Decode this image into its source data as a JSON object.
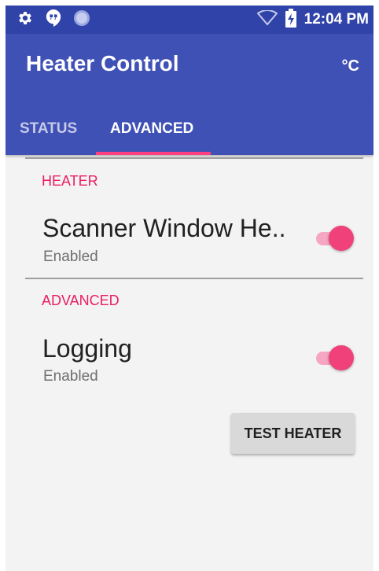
{
  "status_bar": {
    "time": "12:04 PM",
    "icons": [
      "settings-icon",
      "hangouts-icon",
      "sync-circle-icon",
      "wifi-icon",
      "battery-charging-icon"
    ]
  },
  "app_bar": {
    "title": "Heater Control",
    "unit_label": "°C"
  },
  "tabs": [
    {
      "label": "STATUS",
      "selected": false
    },
    {
      "label": "ADVANCED",
      "selected": true
    }
  ],
  "sections": [
    {
      "header": "HEATER",
      "preference": {
        "title": "Scanner Window He..",
        "summary": "Enabled",
        "enabled": true
      }
    },
    {
      "header": "ADVANCED",
      "preference": {
        "title": "Logging",
        "summary": "Enabled",
        "enabled": true
      }
    }
  ],
  "actions": {
    "test_heater_label": "TEST HEATER"
  },
  "colors": {
    "status_bar": "#3043a8",
    "primary": "#3f51b5",
    "accent": "#ff4081",
    "section_header": "#e91e63",
    "background": "#f3f3f3"
  }
}
